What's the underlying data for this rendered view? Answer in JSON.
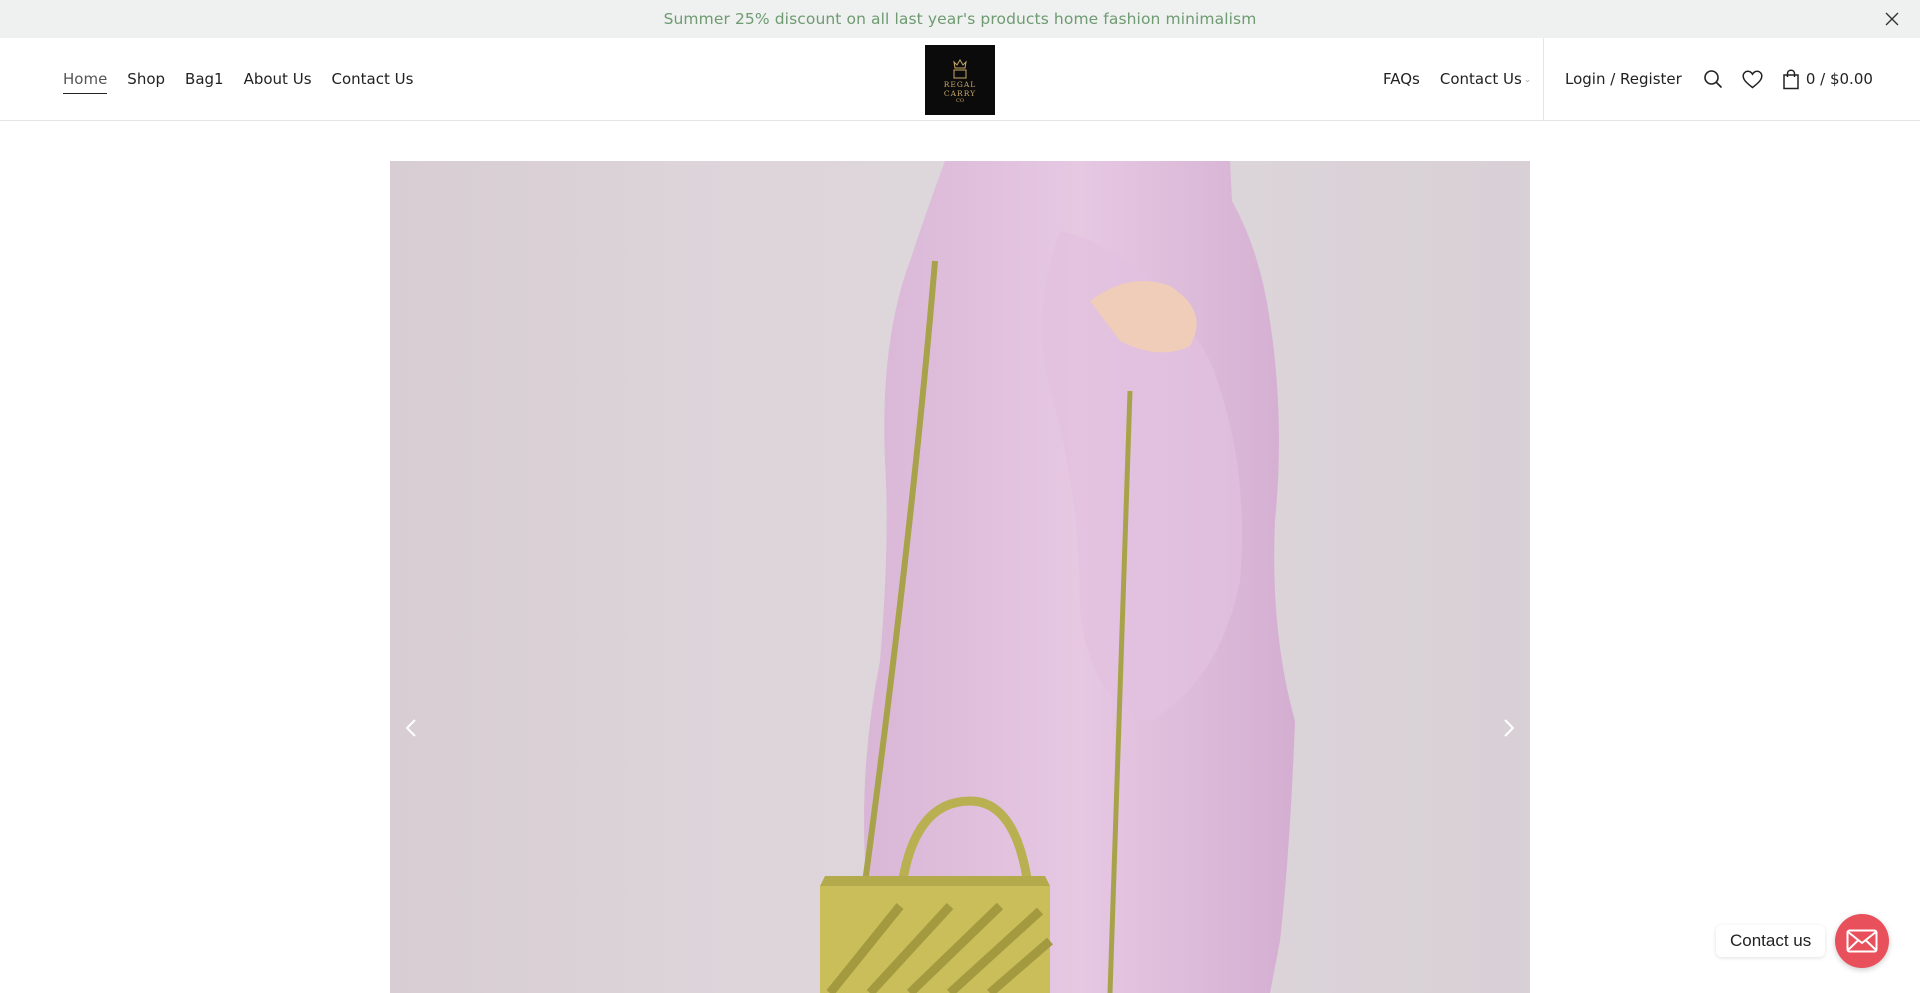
{
  "announcement": {
    "text": "Summer 25% discount on all last year's products home fashion minimalism"
  },
  "nav_left": [
    {
      "label": "Home"
    },
    {
      "label": "Shop"
    },
    {
      "label": "Bag1"
    },
    {
      "label": "About Us"
    },
    {
      "label": "Contact Us"
    }
  ],
  "logo": {
    "line1": "REGAL",
    "line2": "CARRY",
    "line3": "CO"
  },
  "nav_right": {
    "faqs": "FAQs",
    "contact": "Contact Us"
  },
  "account": {
    "login": "Login / Register"
  },
  "cart": {
    "summary": "0 / $0.00"
  },
  "floating_contact": {
    "label": "Contact us"
  },
  "colors": {
    "announcement_bg": "#eef1ef",
    "announcement_text": "#6f9a72",
    "contact_button": "#e8505b",
    "logo_bg": "#0b0b0b",
    "logo_gold": "#c9a86a"
  }
}
